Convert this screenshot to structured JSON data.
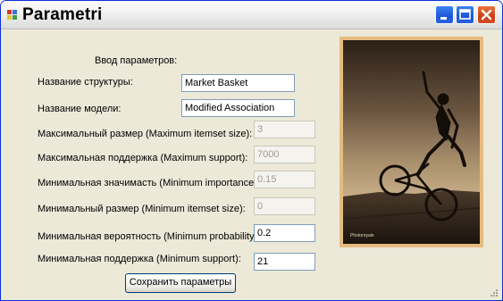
{
  "window": {
    "title": "Parametri"
  },
  "form": {
    "header": "Ввод параметров:",
    "fields": [
      {
        "label": "Название структуры:",
        "value": "Market Basket",
        "enabled": true
      },
      {
        "label": "Название модели:",
        "value": "Modified Association",
        "enabled": true
      },
      {
        "label": "Максимальный размер (Maximum itemset size):",
        "value": "3",
        "enabled": false
      },
      {
        "label": "Максимальная поддержка (Maximum support):",
        "value": "7000",
        "enabled": false
      },
      {
        "label": "Минимальная значимасть (Minimum importance):",
        "value": "0.15",
        "enabled": false
      },
      {
        "label": "Минимальный размер (Minimum itemset size):",
        "value": "0",
        "enabled": false
      },
      {
        "label": "Минимальная вероятность (Minimum probability):",
        "value": "0.2",
        "enabled": true
      },
      {
        "label": "Минимальная поддержка (Minimum support):",
        "value": "21",
        "enabled": true
      }
    ],
    "save_button": "Сохранить параметры"
  },
  "photo": {
    "caption": "Photoroyale",
    "frame_color": "#e5bb7f"
  }
}
